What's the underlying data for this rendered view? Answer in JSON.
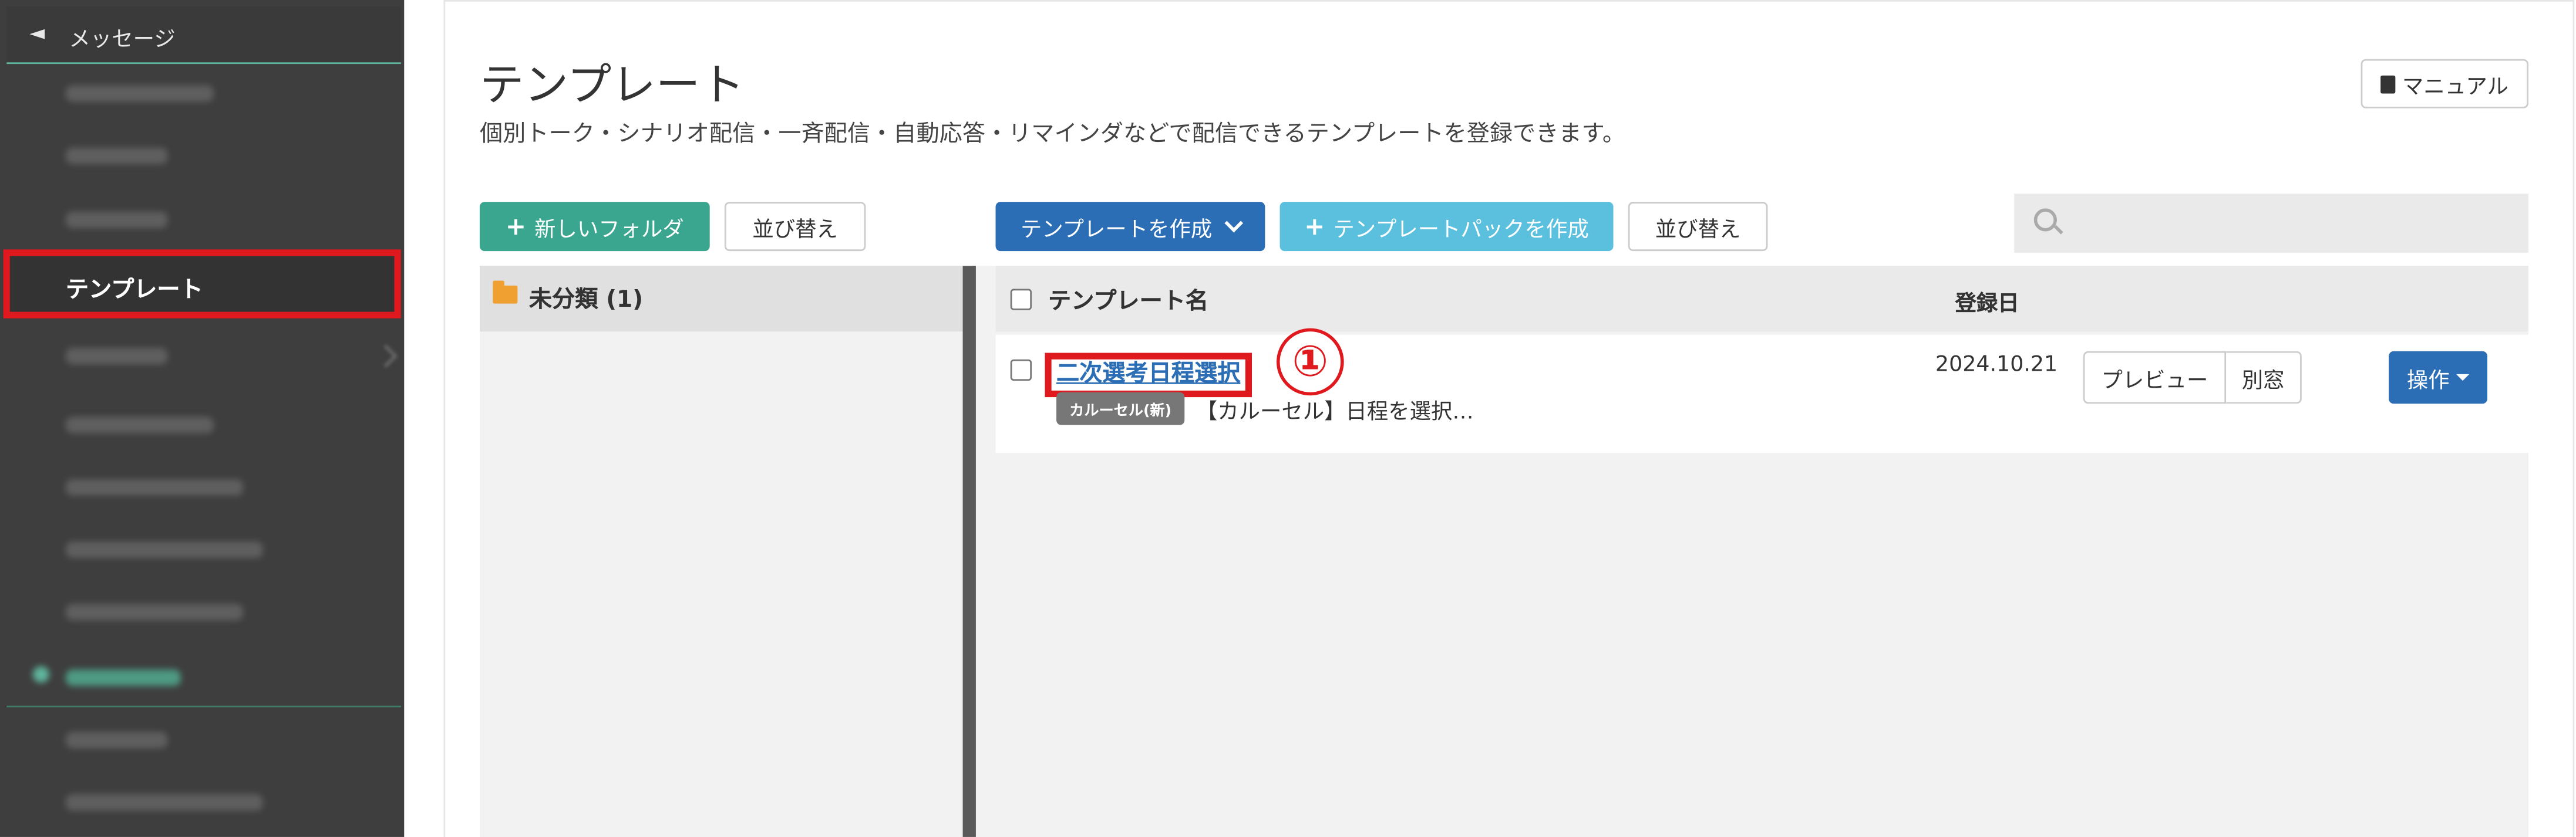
{
  "sidebar": {
    "header_icon": "megaphone-icon",
    "header_label": "メッセージ",
    "active_item_label": "テンプレート"
  },
  "page": {
    "title": "テンプレート",
    "subtitle": "個別トーク・シナリオ配信・一斉配信・自動応答・リマインダなどで配信できるテンプレートを登録できます。",
    "manual_label": "マニュアル"
  },
  "toolbar": {
    "new_folder_label": "新しいフォルダ",
    "sort_label": "並び替え",
    "create_template_label": "テンプレートを作成",
    "create_pack_label": "テンプレートパックを作成",
    "sort_label_2": "並び替え",
    "search_placeholder": ""
  },
  "folders": [
    {
      "label": "未分類 (1)"
    }
  ],
  "table": {
    "col_name": "テンプレート名",
    "col_date": "登録日",
    "rows": [
      {
        "name": "二次選考日程選択",
        "badge": "カルーセル(新)",
        "description": "【カルーセル】日程を選択…",
        "date": "2024.10.21",
        "preview_label": "プレビュー",
        "new_window_label": "別窓",
        "action_label": "操作"
      }
    ]
  },
  "annotation": {
    "marker": "①"
  },
  "colors": {
    "accent_green": "#3ba68f",
    "primary_blue": "#2c6eb5",
    "light_blue": "#5bc0de",
    "highlight_red": "#e0191e",
    "sidebar_bg": "#3e3e3e"
  }
}
